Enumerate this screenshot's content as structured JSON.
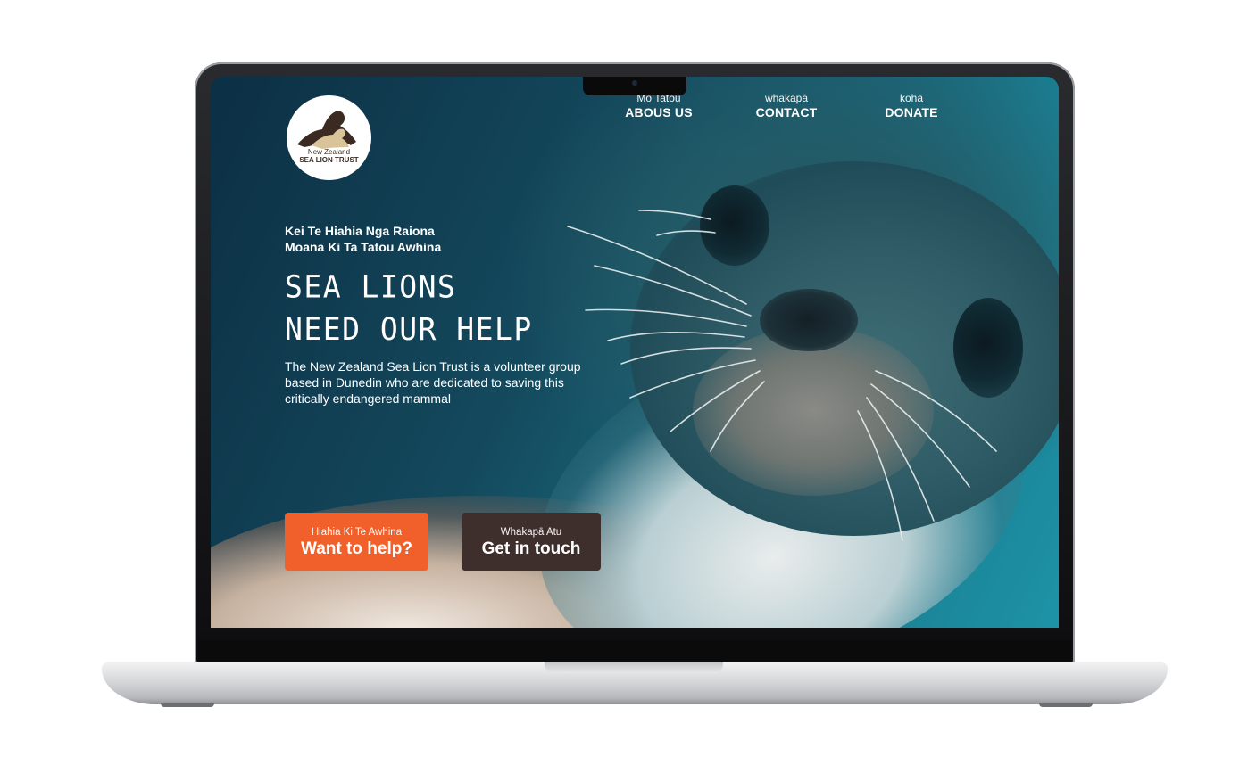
{
  "logo": {
    "line1": "New Zealand",
    "line2": "SEA LION TRUST"
  },
  "nav": [
    {
      "sub": "Mo Tatou",
      "main": "ABOUS US"
    },
    {
      "sub": "whakapā",
      "main": "CONTACT"
    },
    {
      "sub": "koha",
      "main": "DONATE"
    }
  ],
  "hero": {
    "tagline": "Kei Te Hiahia Nga Raiona\nMoana Ki Ta Tatou Awhina",
    "headline_line1": "SEA LIONS",
    "headline_line2": "NEED OUR HELP",
    "description": "The New Zealand Sea Lion Trust is a volunteer group based in Dunedin who are dedicated to saving this critically endangered mammal"
  },
  "buttons": {
    "help": {
      "sub": "Hiahia Ki Te Awhina",
      "main": "Want to help?",
      "color": "#f1602b"
    },
    "touch": {
      "sub": "Whakapā Atu",
      "main": "Get in touch",
      "color": "#3e2f2c"
    }
  }
}
